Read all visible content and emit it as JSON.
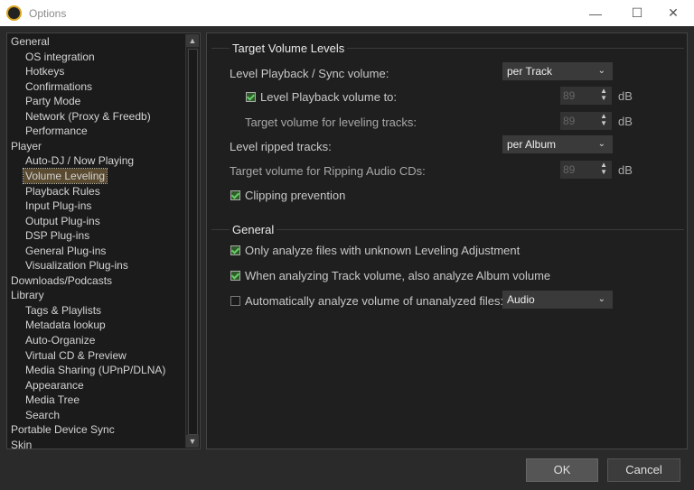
{
  "window": {
    "title": "Options",
    "minimize": "—",
    "maximize": "☐",
    "close": "✕"
  },
  "tree": [
    {
      "label": "General",
      "level": 0
    },
    {
      "label": "OS integration",
      "level": 1
    },
    {
      "label": "Hotkeys",
      "level": 1
    },
    {
      "label": "Confirmations",
      "level": 1
    },
    {
      "label": "Party Mode",
      "level": 1
    },
    {
      "label": "Network (Proxy & Freedb)",
      "level": 1
    },
    {
      "label": "Performance",
      "level": 1
    },
    {
      "label": "Player",
      "level": 0
    },
    {
      "label": "Auto-DJ / Now Playing",
      "level": 1
    },
    {
      "label": "Volume Leveling",
      "level": 1,
      "selected": true
    },
    {
      "label": "Playback Rules",
      "level": 1
    },
    {
      "label": "Input Plug-ins",
      "level": 1
    },
    {
      "label": "Output Plug-ins",
      "level": 1
    },
    {
      "label": "DSP Plug-ins",
      "level": 1
    },
    {
      "label": "General Plug-ins",
      "level": 1
    },
    {
      "label": "Visualization Plug-ins",
      "level": 1
    },
    {
      "label": "Downloads/Podcasts",
      "level": 0
    },
    {
      "label": "Library",
      "level": 0
    },
    {
      "label": "Tags & Playlists",
      "level": 1
    },
    {
      "label": "Metadata lookup",
      "level": 1
    },
    {
      "label": "Auto-Organize",
      "level": 1
    },
    {
      "label": "Virtual CD & Preview",
      "level": 1
    },
    {
      "label": "Media Sharing (UPnP/DLNA)",
      "level": 1
    },
    {
      "label": "Appearance",
      "level": 1
    },
    {
      "label": "Media Tree",
      "level": 1
    },
    {
      "label": "Search",
      "level": 1
    },
    {
      "label": "Portable Device Sync",
      "level": 0
    },
    {
      "label": "Skin",
      "level": 0
    }
  ],
  "target": {
    "title": "Target Volume Levels",
    "level_playback_label": "Level Playback / Sync volume:",
    "level_playback_value": "per Track",
    "level_playback_to_label": "Level Playback volume to:",
    "level_playback_to_checked": true,
    "level_playback_to_value": "89",
    "target_leveling_label": "Target volume for leveling tracks:",
    "target_leveling_value": "89",
    "ripped_label": "Level ripped tracks:",
    "ripped_value": "per Album",
    "ripping_target_label": "Target volume for Ripping Audio CDs:",
    "ripping_target_value": "89",
    "clipping_label": "Clipping prevention",
    "clipping_checked": true,
    "unit": "dB"
  },
  "general": {
    "title": "General",
    "only_unknown_label": "Only analyze files with unknown Leveling Adjustment",
    "only_unknown_checked": true,
    "album_label": "When analyzing Track volume, also analyze Album volume",
    "album_checked": true,
    "auto_label": "Automatically analyze volume of unanalyzed files:",
    "auto_checked": false,
    "auto_value": "Audio"
  },
  "buttons": {
    "ok": "OK",
    "cancel": "Cancel"
  }
}
